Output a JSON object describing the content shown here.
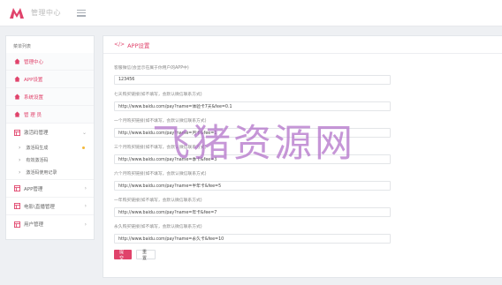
{
  "header": {
    "brand": "管理中心",
    "logo": "M-logo",
    "menu_icon": "hamburger-icon",
    "accent": "#e0436b"
  },
  "sidebar": {
    "title": "菜单列表",
    "items": [
      {
        "label": "管理中心",
        "icon": "home-icon",
        "active": true
      },
      {
        "label": "APP设置",
        "icon": "home-icon",
        "active": true
      },
      {
        "label": "系统设置",
        "icon": "home-icon",
        "active": true
      },
      {
        "label": "管 理 员",
        "icon": "home-icon",
        "active": true
      },
      {
        "label": "激活码管理",
        "icon": "grid-icon",
        "expanded": true,
        "children": [
          {
            "label": "激活码生成",
            "badge": true
          },
          {
            "label": "有效激活码"
          },
          {
            "label": "激活码使用记录"
          }
        ]
      },
      {
        "label": "APP管理",
        "icon": "grid-icon"
      },
      {
        "label": "电影\\直播管理",
        "icon": "grid-icon"
      },
      {
        "label": "用户管理",
        "icon": "grid-icon"
      }
    ]
  },
  "panel": {
    "title": "APP设置",
    "icon": "code-icon",
    "fields": [
      {
        "label": "客服微信(会显示在属于你用户的APP中)",
        "value": "123456"
      },
      {
        "label": "七天购买链接(如不填写，会默认微信联系方式)",
        "value": "http://www.baidu.com/pay?name=体验卡7天&fee=0.1"
      },
      {
        "label": "一个月购买链接(如不填写，会默认微信联系方式)",
        "value": "http://www.baidu.com/pay?name=月卡&fee=1"
      },
      {
        "label": "三个月购买链接(如不填写，会默认微信联系方式)",
        "value": "http://www.baidu.com/pay?name=季卡&fee=3"
      },
      {
        "label": "六个月购买链接(如不填写，会默认微信联系方式)",
        "value": "http://www.baidu.com/pay?name=半年卡&fee=5"
      },
      {
        "label": "一年购买链接(如不填写，会默认微信联系方式)",
        "value": "http://www.baidu.com/pay?name=年卡&fee=7"
      },
      {
        "label": "永久购买链接(如不填写，会默认微信联系方式)",
        "value": "http://www.baidu.com/pay?name=永久卡&fee=10"
      }
    ],
    "submit_label": "提交",
    "reset_label": "重置"
  },
  "watermark": "飞猪资源网"
}
